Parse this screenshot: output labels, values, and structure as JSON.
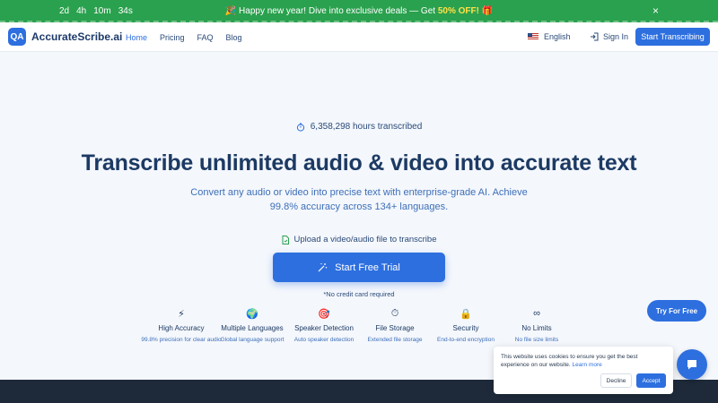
{
  "promo": {
    "countdown": [
      "2d",
      "4h",
      "10m",
      "34s"
    ],
    "icon_left": "🎉",
    "message": "Happy new year! Dive into exclusive deals — Get",
    "highlight": "50% OFF!",
    "icon_right": "🎁",
    "close_icon": "×"
  },
  "nav": {
    "logo_mark": "QA",
    "logo_text": "AccurateScribe.ai",
    "links": [
      "Home",
      "Pricing",
      "FAQ",
      "Blog"
    ],
    "language": "English",
    "signin": "Sign In",
    "cta": "Start Transcribing"
  },
  "hero": {
    "stat": "6,358,298 hours transcribed",
    "title": "Transcribe unlimited audio & video into accurate text",
    "subtitle": "Convert any audio or video into precise text with enterprise-grade AI. Achieve 99.8% accuracy across 134+ languages.",
    "upload_label": "Upload a video/audio file to transcribe",
    "trial_button": "Start Free Trial",
    "no_card": "*No credit card required"
  },
  "features": [
    {
      "icon": "lightning-icon",
      "glyph": "⚡",
      "title": "High Accuracy",
      "desc": "99.8% precision for clear audio"
    },
    {
      "icon": "globe-icon",
      "glyph": "🌍",
      "title": "Multiple Languages",
      "desc": "Global language support"
    },
    {
      "icon": "target-icon",
      "glyph": "🎯",
      "title": "Speaker Detection",
      "desc": "Auto speaker detection"
    },
    {
      "icon": "timer-icon",
      "glyph": "⏱",
      "title": "File Storage",
      "desc": "Extended file storage"
    },
    {
      "icon": "lock-icon",
      "glyph": "🔒",
      "title": "Security",
      "desc": "End-to-end encryption"
    },
    {
      "icon": "infinity-icon",
      "glyph": "∞",
      "title": "No Limits",
      "desc": "No file size limits"
    }
  ],
  "try_free": "Try For Free",
  "cookie": {
    "text": "This website uses cookies to ensure you get the best experience on our website.",
    "link": "Learn more",
    "decline": "Decline",
    "accept": "Accept"
  },
  "colors": {
    "accent": "#2d6fdf",
    "promo_bg": "#2aa14e",
    "footer_band": "#1e2a3a"
  }
}
